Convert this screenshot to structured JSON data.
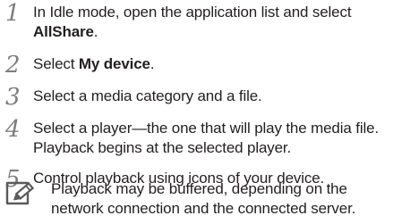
{
  "steps": [
    {
      "number": "1",
      "line1": "In Idle mode, open the application list and select",
      "line2_bold": "AllShare",
      "line2_after": "."
    },
    {
      "number": "2",
      "before": "Select ",
      "bold": "My device",
      "after": "."
    },
    {
      "number": "3",
      "text": "Select a media category and a file."
    },
    {
      "number": "4",
      "line1": "Select a player—the one that will play the media file.",
      "line2": "Playback begins at the selected player."
    },
    {
      "number": "5",
      "text": "Control playback using icons of your device."
    }
  ],
  "note": {
    "icon": "note-pencil-icon",
    "line1": "Playback may be buffered, depending on the",
    "line2": "network connection and the connected server."
  }
}
